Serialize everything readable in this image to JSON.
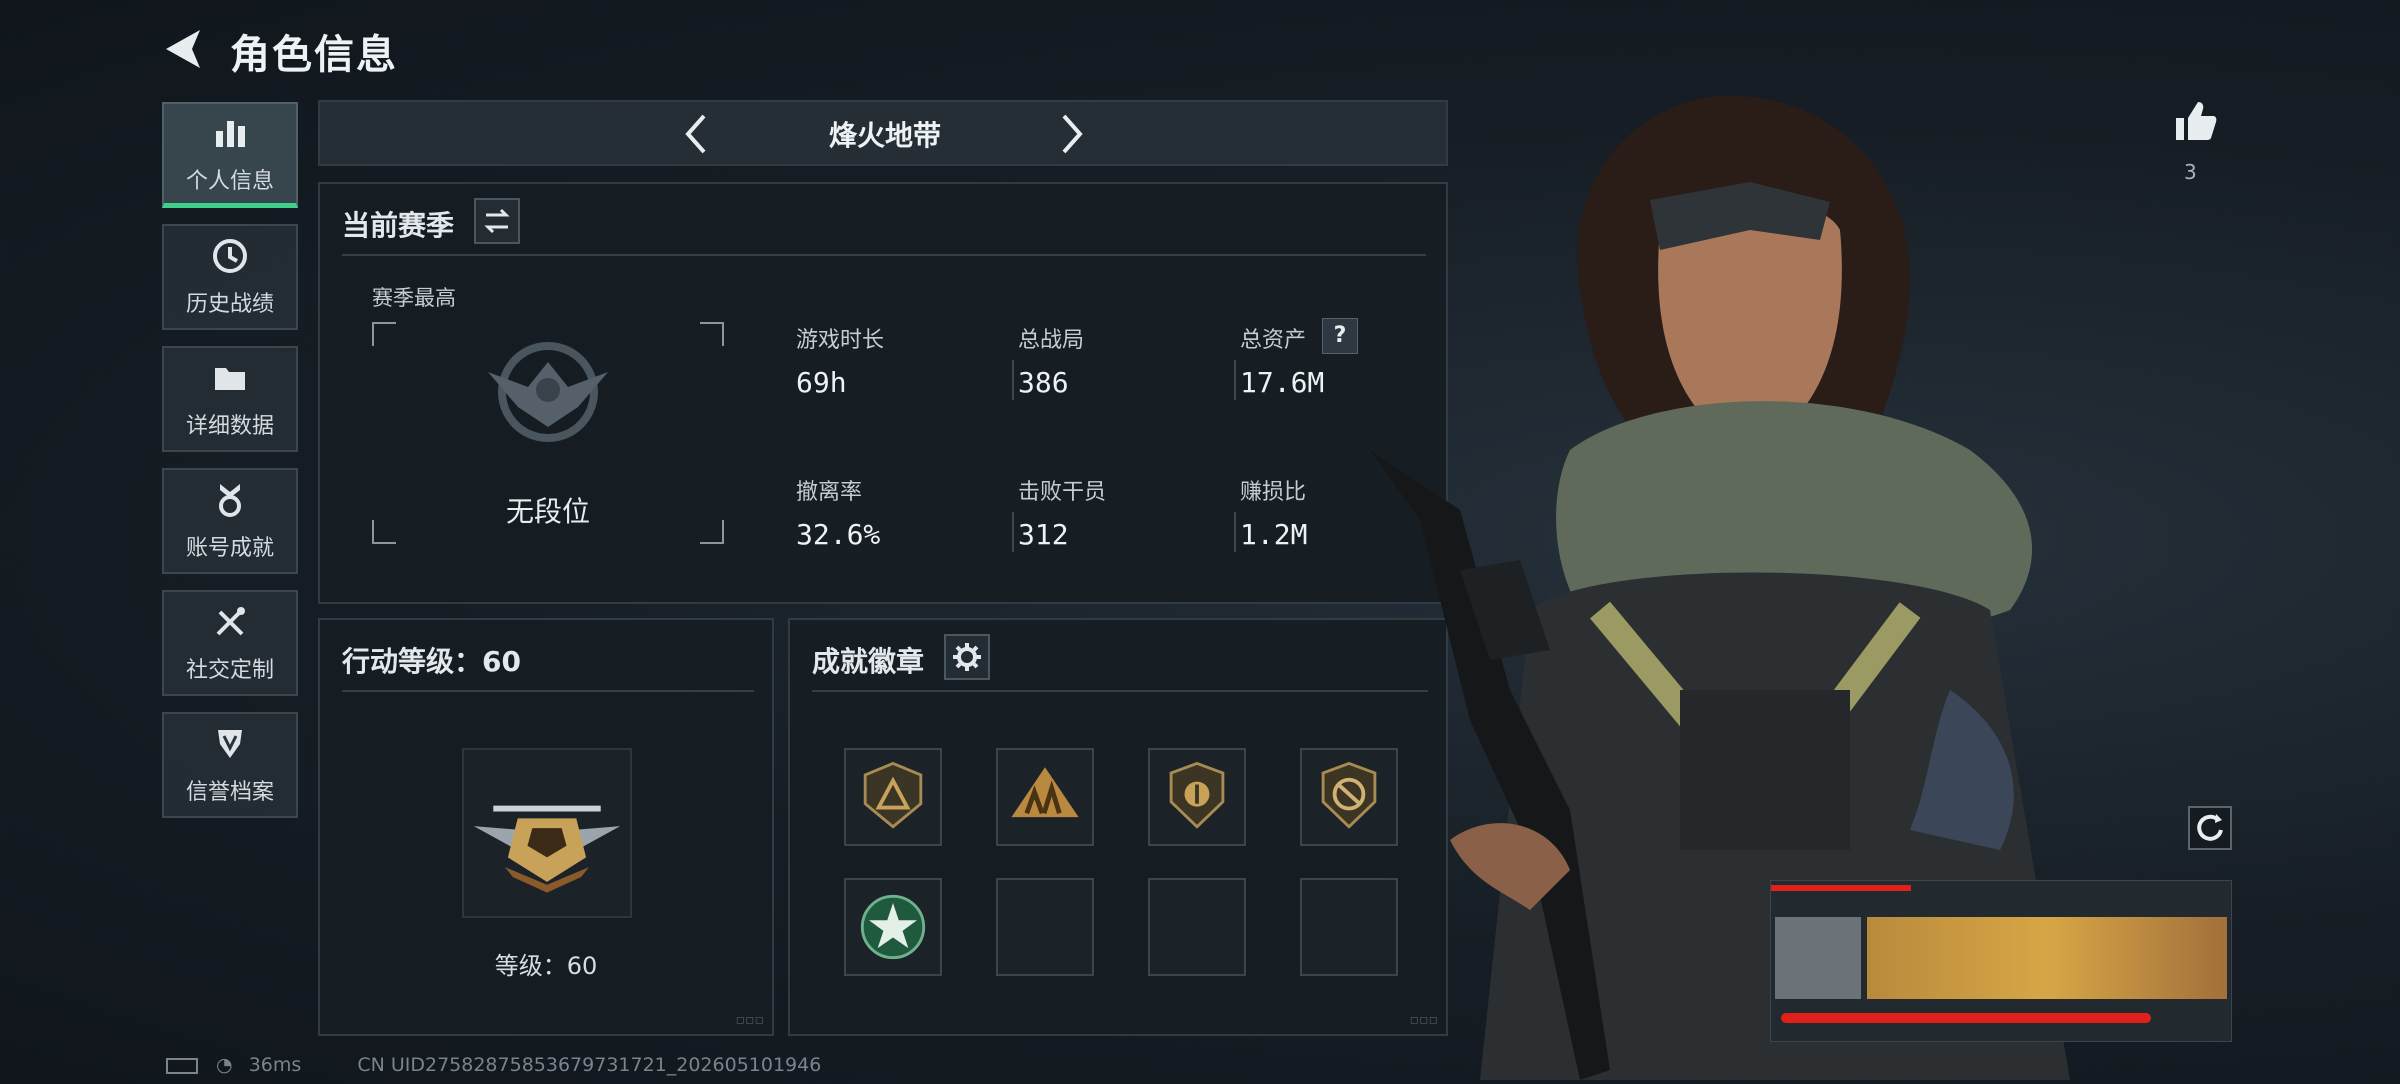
{
  "header": {
    "title": "角色信息",
    "back_icon": "back-arrow-icon"
  },
  "nav": {
    "items": [
      {
        "label": "个人信息",
        "icon": "bar-chart-icon",
        "active": true
      },
      {
        "label": "历史战绩",
        "icon": "clock-icon",
        "active": false
      },
      {
        "label": "详细数据",
        "icon": "folder-icon",
        "active": false
      },
      {
        "label": "账号成就",
        "icon": "medal-icon",
        "active": false
      },
      {
        "label": "社交定制",
        "icon": "tools-icon",
        "active": false
      },
      {
        "label": "信誉档案",
        "icon": "shield-icon",
        "active": false
      }
    ]
  },
  "mode": {
    "label": "烽火地带"
  },
  "season": {
    "title": "当前赛季",
    "best_label": "赛季最高",
    "rank_text": "无段位",
    "stats": [
      {
        "label": "游戏时长",
        "value": "69h"
      },
      {
        "label": "总战局",
        "value": "386"
      },
      {
        "label": "总资产",
        "value": "17.6M",
        "help": "?"
      },
      {
        "label": "撤离率",
        "value": "32.6%"
      },
      {
        "label": "击败干员",
        "value": "312"
      },
      {
        "label": "赚损比",
        "value": "1.2M"
      }
    ]
  },
  "action_level": {
    "title": "行动等级：60",
    "level_text": "等级：60",
    "level": 60
  },
  "badges": {
    "title": "成就徽章"
  },
  "like": {
    "count": "3"
  },
  "status": {
    "latency": "36ms",
    "uid_text": "CN UID27582875853679731721_202605101946"
  },
  "colors": {
    "accent": "#3fd18a",
    "gold": "#c9a25a",
    "panel": "#161d23"
  }
}
